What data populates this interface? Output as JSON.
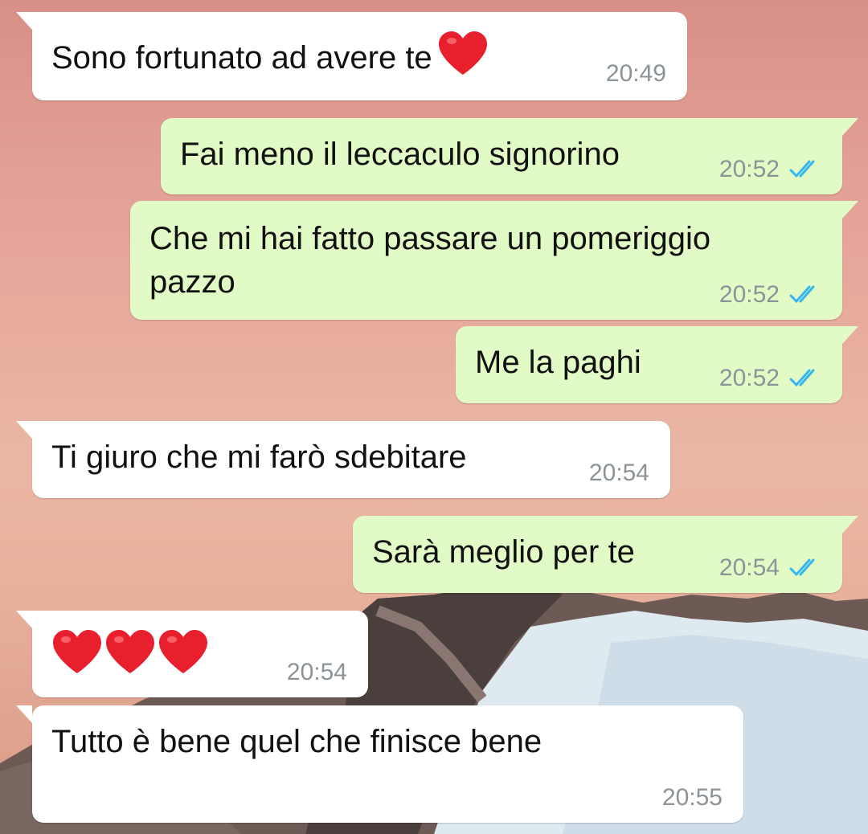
{
  "colors": {
    "incoming_bubble": "#ffffff",
    "outgoing_bubble": "#e2fbc6",
    "timestamp": "#8c9398",
    "read_ticks": "#34b7f1",
    "heart": "#e8202e"
  },
  "messages": [
    {
      "direction": "incoming",
      "text": "Sono fortunato ad avere te",
      "emoji": "red-heart",
      "time": "20:49"
    },
    {
      "direction": "outgoing",
      "text": "Fai meno il leccaculo signorino",
      "time": "20:52",
      "status": "read"
    },
    {
      "direction": "outgoing",
      "text": "Che mi hai fatto passare un pomeriggio pazzo",
      "time": "20:52",
      "status": "read"
    },
    {
      "direction": "outgoing",
      "text": "Me la paghi",
      "time": "20:52",
      "status": "read"
    },
    {
      "direction": "incoming",
      "text": "Ti giuro che mi farò sdebitare",
      "time": "20:54"
    },
    {
      "direction": "outgoing",
      "text": "Sarà meglio per te",
      "time": "20:54",
      "status": "read"
    },
    {
      "direction": "incoming",
      "emoji": "red-heart x3",
      "time": "20:54"
    },
    {
      "direction": "incoming",
      "text": "Tutto è bene quel che finisce bene",
      "time": "20:55"
    }
  ]
}
